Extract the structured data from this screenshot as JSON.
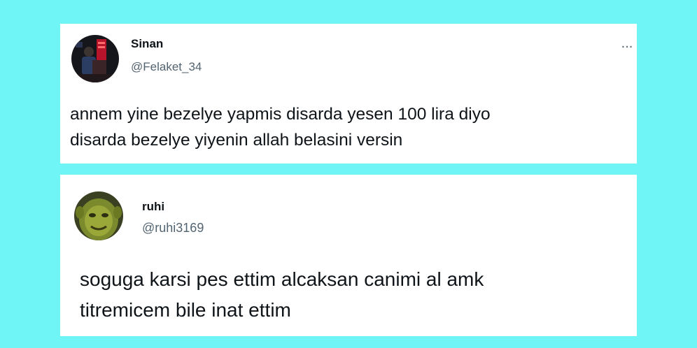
{
  "tweets": [
    {
      "display_name": "Sinan",
      "handle": "@Felaket_34",
      "more_label": "...",
      "avatar_icon": "profile-photo-icon",
      "lines": [
        "annem yine bezelye yapmis disarda yesen 100 lira diyo",
        "disarda bezelye yiyenin allah belasini versin"
      ]
    },
    {
      "display_name": "ruhi",
      "handle": "@ruhi3169",
      "avatar_icon": "profile-photo-icon",
      "lines": [
        "soguga karsi pes ettim alcaksan canimi al amk",
        "titremicem bile inat ettim"
      ]
    }
  ],
  "colors": {
    "background": "#6ff5f5",
    "card": "#ffffff",
    "text": "#0f1419",
    "secondary_text": "#536471"
  }
}
